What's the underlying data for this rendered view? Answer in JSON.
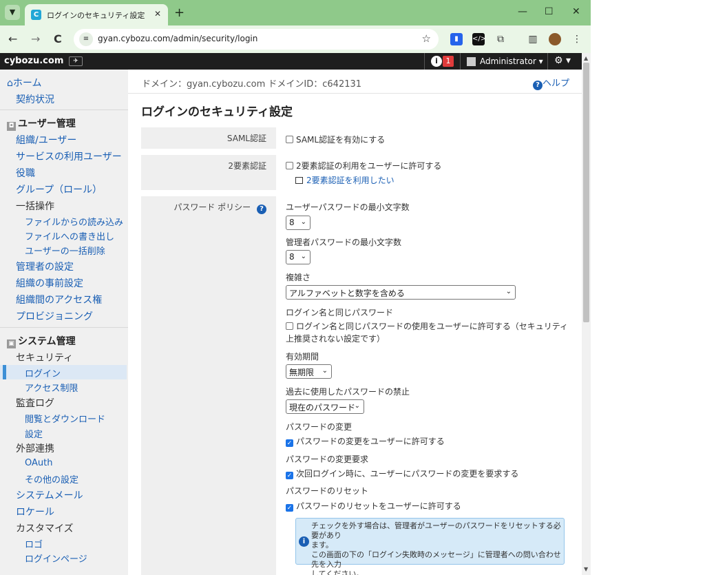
{
  "browser": {
    "tab_title": "ログインのセキュリティ設定",
    "favicon": "C",
    "close_tab": "✕",
    "new_tab": "+",
    "minimize": "—",
    "maximize": "☐",
    "close_window": "✕",
    "back": "←",
    "forward": "→",
    "reload": "C",
    "url": "gyan.cybozu.com/admin/security/login",
    "bookmark_star": "☆"
  },
  "header": {
    "logo": "cybozu.com",
    "notification_count": "1",
    "user": "Administrator ▾",
    "settings": "⚙ ▾"
  },
  "sidebar": {
    "home": "ホーム",
    "contract": "契約状況",
    "user_mgmt": "ユーザー管理",
    "org_users": "組織/ユーザー",
    "service_users": "サービスの利用ユーザー",
    "roles": "役職",
    "groups": "グループ（ロール）",
    "bulk_ops": "一括操作",
    "import_file": "ファイルからの読み込み",
    "export_file": "ファイルへの書き出し",
    "bulk_delete": "ユーザーの一括削除",
    "admin_settings": "管理者の設定",
    "org_presets": "組織の事前設定",
    "org_access": "組織間のアクセス権",
    "provisioning": "プロビジョニング",
    "system_mgmt": "システム管理",
    "security": "セキュリティ",
    "login": "ログイン",
    "access_control": "アクセス制限",
    "audit_log": "監査ログ",
    "view_download": "閲覧とダウンロード",
    "audit_settings": "設定",
    "external": "外部連携",
    "oauth": "OAuth",
    "other_settings": "その他の設定",
    "system_mail": "システムメール",
    "locale": "ロケール",
    "customize": "カスタマイズ",
    "logo": "ロゴ",
    "login_page": "ログインページ"
  },
  "content": {
    "domain_info": "ドメイン：gyan.cybozu.com  ドメインID：c642131",
    "help": "ヘルプ",
    "page_title": "ログインのセキュリティ設定",
    "saml_label": "SAML認証",
    "saml_enable": "SAML認証を有効にする",
    "twofa_label": "2要素認証",
    "twofa_allow": "2要素認証の利用をユーザーに許可する",
    "twofa_link": "2要素認証を利用したい",
    "policy_label": "パスワード ポリシー",
    "min_user_len_label": "ユーザーパスワードの最小文字数",
    "min_user_len_value": "8",
    "min_admin_len_label": "管理者パスワードの最小文字数",
    "min_admin_len_value": "8",
    "complexity_label": "複雑さ",
    "complexity_value": "アルファベットと数字を含める",
    "same_as_login_label": "ログイン名と同じパスワード",
    "same_as_login_line1": "ログイン名と同じパスワードの使用をユーザーに許可する（セキュリティ",
    "same_as_login_line2": "上推奨されない設定です）",
    "expiry_label": "有効期間",
    "expiry_value": "無期限",
    "history_label": "過去に使用したパスワードの禁止",
    "history_value": "現在のパスワード",
    "change_label": "パスワードの変更",
    "change_allow": "パスワードの変更をユーザーに許可する",
    "change_req_label": "パスワードの変更要求",
    "change_req_check": "次回ログイン時に、ユーザーにパスワードの変更を要求する",
    "reset_label": "パスワードのリセット",
    "reset_allow": "パスワードのリセットをユーザーに許可する",
    "notice_line1": "チェックを外す場合は、管理者がユーザーのパスワードをリセットする必要があり",
    "notice_line2": "ます。",
    "notice_line3": "この画面の下の「ログイン失敗時のメッセージ」に管理者への問い合わせ先を入力",
    "notice_line4": "してください。"
  },
  "colors": {
    "tabstrip": "#8fc98a",
    "header": "#1e1e1e",
    "link": "#1a5fb4",
    "badge": "#e03b3b",
    "selected": "#dce8f5",
    "notice": "#d6eaf8"
  }
}
